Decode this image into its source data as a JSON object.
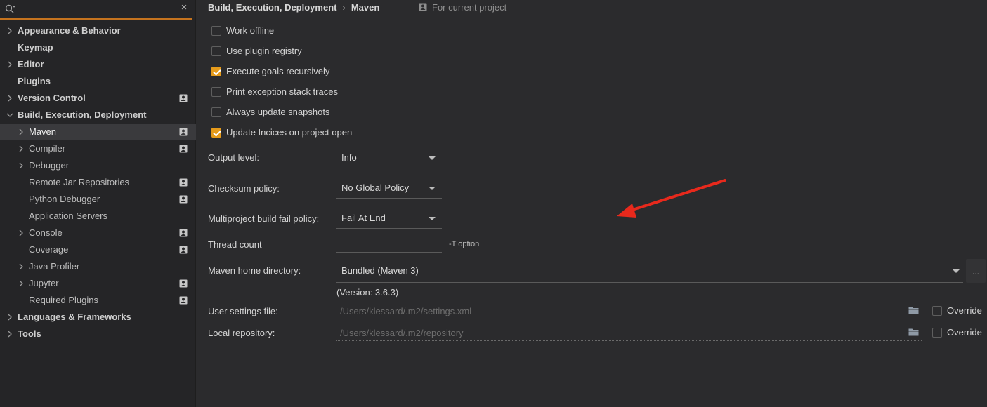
{
  "search": {
    "value": "",
    "placeholder": ""
  },
  "sidebar": {
    "items": [
      {
        "label": "Appearance & Behavior",
        "level": 0,
        "expandable": true,
        "expanded": false,
        "project_scope": false
      },
      {
        "label": "Keymap",
        "level": 0,
        "expandable": false,
        "project_scope": false
      },
      {
        "label": "Editor",
        "level": 0,
        "expandable": true,
        "expanded": false,
        "project_scope": false
      },
      {
        "label": "Plugins",
        "level": 0,
        "expandable": false,
        "project_scope": false
      },
      {
        "label": "Version Control",
        "level": 0,
        "expandable": true,
        "expanded": false,
        "project_scope": true
      },
      {
        "label": "Build, Execution, Deployment",
        "level": 0,
        "expandable": true,
        "expanded": true,
        "project_scope": false
      },
      {
        "label": "Maven",
        "level": 1,
        "expandable": true,
        "expanded": false,
        "project_scope": true,
        "selected": true
      },
      {
        "label": "Compiler",
        "level": 1,
        "expandable": true,
        "expanded": false,
        "project_scope": true
      },
      {
        "label": "Debugger",
        "level": 1,
        "expandable": true,
        "expanded": false,
        "project_scope": false
      },
      {
        "label": "Remote Jar Repositories",
        "level": 1,
        "expandable": false,
        "project_scope": true
      },
      {
        "label": "Python Debugger",
        "level": 1,
        "expandable": false,
        "project_scope": true
      },
      {
        "label": "Application Servers",
        "level": 1,
        "expandable": false,
        "project_scope": false
      },
      {
        "label": "Console",
        "level": 1,
        "expandable": true,
        "expanded": false,
        "project_scope": true
      },
      {
        "label": "Coverage",
        "level": 1,
        "expandable": false,
        "project_scope": true
      },
      {
        "label": "Java Profiler",
        "level": 1,
        "expandable": true,
        "expanded": false,
        "project_scope": false
      },
      {
        "label": "Jupyter",
        "level": 1,
        "expandable": true,
        "expanded": false,
        "project_scope": true
      },
      {
        "label": "Required Plugins",
        "level": 1,
        "expandable": false,
        "project_scope": true
      },
      {
        "label": "Languages & Frameworks",
        "level": 0,
        "expandable": true,
        "expanded": false,
        "project_scope": false
      },
      {
        "label": "Tools",
        "level": 0,
        "expandable": true,
        "expanded": false,
        "project_scope": false
      }
    ]
  },
  "breadcrumb": {
    "parent": "Build, Execution, Deployment",
    "separator": "›",
    "current": "Maven",
    "scope_label": "For current project"
  },
  "options": [
    {
      "label": "Work offline",
      "checked": false
    },
    {
      "label": "Use plugin registry",
      "checked": false
    },
    {
      "label": "Execute goals recursively",
      "checked": true
    },
    {
      "label": "Print exception stack traces",
      "checked": false
    },
    {
      "label": "Always update snapshots",
      "checked": false
    },
    {
      "label": "Update Incices on project open",
      "checked": true
    }
  ],
  "fields": {
    "output_level": {
      "label": "Output level:",
      "value": "Info"
    },
    "checksum_policy": {
      "label": "Checksum policy:",
      "value": "No Global Policy"
    },
    "fail_policy": {
      "label": "Multiproject build fail policy:",
      "value": "Fail At End"
    },
    "thread_count": {
      "label": "Thread count",
      "value": "",
      "hint": "-T option"
    },
    "maven_home": {
      "label": "Maven home directory:",
      "value": "Bundled (Maven 3)",
      "browse_label": "...",
      "version": "(Version: 3.6.3)"
    },
    "user_settings": {
      "label": "User settings file:",
      "value": "/Users/klessard/.m2/settings.xml",
      "override_label": "Override",
      "override_checked": false
    },
    "local_repo": {
      "label": "Local repository:",
      "value": "/Users/klessard/.m2/repository",
      "override_label": "Override",
      "override_checked": false
    }
  },
  "colors": {
    "accent": "#e59b1b",
    "annotation_arrow": "#e8291c",
    "background": "#2b2b2d",
    "sidebar_background": "#252527"
  },
  "icons": {
    "search": "search-icon",
    "clear": "close-icon",
    "project_scope": "project-scope-icon",
    "folder": "folder-icon",
    "chevron": "chevron-right-icon"
  }
}
